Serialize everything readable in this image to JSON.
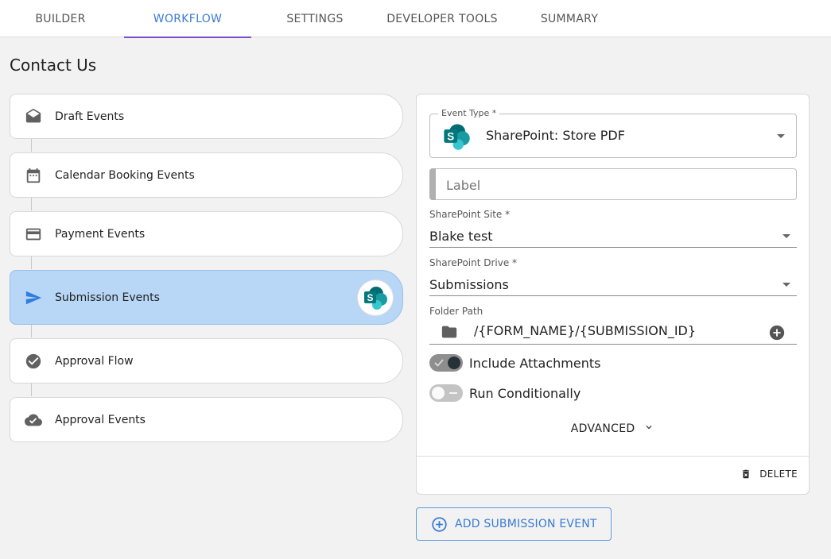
{
  "tabs": [
    {
      "label": "BUILDER"
    },
    {
      "label": "WORKFLOW",
      "active": true
    },
    {
      "label": "SETTINGS"
    },
    {
      "label": "DEVELOPER TOOLS"
    },
    {
      "label": "SUMMARY"
    }
  ],
  "page": {
    "title": "Contact Us"
  },
  "events": [
    {
      "label": "Draft Events",
      "icon": "envelope-open-icon"
    },
    {
      "label": "Calendar Booking Events",
      "icon": "calendar-icon"
    },
    {
      "label": "Payment Events",
      "icon": "credit-card-icon"
    },
    {
      "label": "Submission Events",
      "icon": "send-icon",
      "active": true
    },
    {
      "label": "Approval Flow",
      "icon": "check-circle-icon"
    },
    {
      "label": "Approval Events",
      "icon": "cloud-check-icon"
    }
  ],
  "panel": {
    "event_type": {
      "legend": "Event Type *",
      "value": "SharePoint: Store PDF",
      "icon": "sharepoint-icon"
    },
    "label_field": {
      "placeholder": "Label",
      "value": ""
    },
    "sharepoint_site": {
      "label": "SharePoint Site *",
      "value": "Blake test"
    },
    "sharepoint_drive": {
      "label": "SharePoint Drive *",
      "value": "Submissions"
    },
    "folder_path": {
      "label": "Folder Path",
      "value": "/{FORM_NAME}/{SUBMISSION_ID}"
    },
    "include_attachments": {
      "label": "Include Attachments",
      "checked": true
    },
    "run_conditionally": {
      "label": "Run Conditionally",
      "checked": false
    },
    "advanced_label": "ADVANCED",
    "delete_label": "DELETE"
  },
  "add_button": {
    "label": "ADD SUBMISSION EVENT"
  },
  "colors": {
    "accent": "#3a7bd5",
    "tab_underline": "#7b4bc9",
    "active_card": "#b8d6f5",
    "sharepoint": "#038387"
  }
}
